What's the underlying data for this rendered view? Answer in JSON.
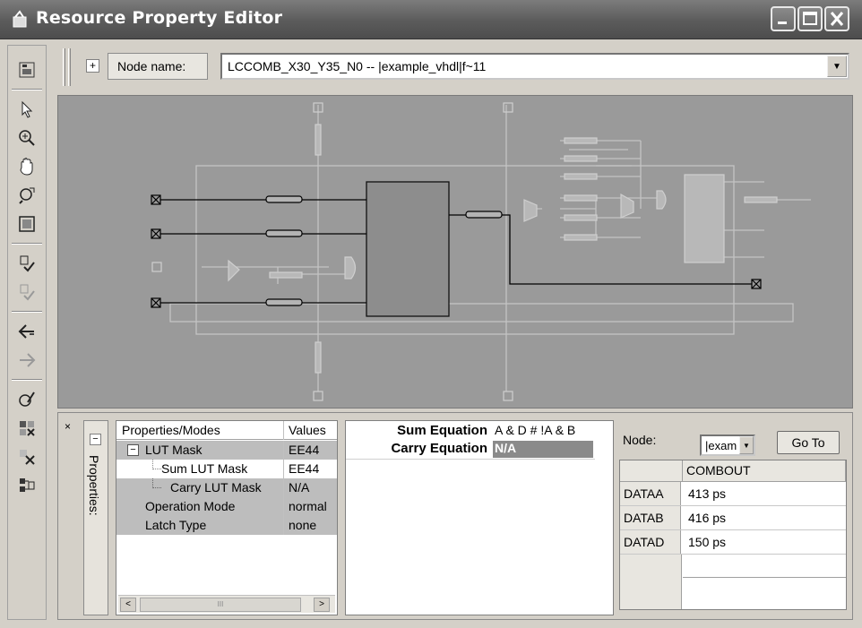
{
  "window": {
    "title": "Resource Property Editor"
  },
  "nodebar": {
    "expand_symbol": "+",
    "node_name_label": "Node name:",
    "node_value": "LCCOMB_X30_Y35_N0 -- |example_vhdl|f~11"
  },
  "left_toolbar": {
    "icons": [
      "node-view-icon",
      "select-icon",
      "zoom-icon",
      "hand-icon",
      "find-icon",
      "fit-window-icon",
      "check-icon",
      "check-disabled-icon",
      "back-icon",
      "forward-icon",
      "edit-icon",
      "cell-icon",
      "clear-icon",
      "connections-icon"
    ]
  },
  "properties_panel": {
    "close_symbol": "×",
    "collapse_symbol": "−",
    "tab_label": "Properties:",
    "columns": [
      "Properties/Modes",
      "Values"
    ],
    "rows": [
      {
        "name": "LUT Mask",
        "value": "EE44",
        "expander": "−"
      },
      {
        "name": "Sum LUT Mask",
        "value": "EE44"
      },
      {
        "name": "Carry LUT Mask",
        "value": "N/A"
      },
      {
        "name": "Operation Mode",
        "value": "normal"
      },
      {
        "name": "Latch Type",
        "value": "none"
      }
    ],
    "scrollbar": {
      "left": "<",
      "right": ">",
      "thumb": "III"
    }
  },
  "equations": {
    "sum_label": "Sum Equation",
    "sum_value": "A & D # !A & B",
    "carry_label": "Carry Equation",
    "carry_value": "N/A"
  },
  "delay_panel": {
    "node_label": "Node:",
    "node_select_value": "|exam",
    "goto_label": "Go To",
    "column_header": "COMBOUT",
    "rows": [
      {
        "name": "DATAA",
        "value": "413 ps"
      },
      {
        "name": "DATAB",
        "value": "416 ps"
      },
      {
        "name": "DATAD",
        "value": "150 ps"
      }
    ]
  },
  "colors": {
    "titlebar": "#5b5b5b",
    "canvas": "#9a9a9a",
    "lut_block": "#8d8d8d",
    "wire_active": "#000000",
    "wire_faded": "#c4c4c4",
    "carry_highlight": "#8a8a8a"
  }
}
